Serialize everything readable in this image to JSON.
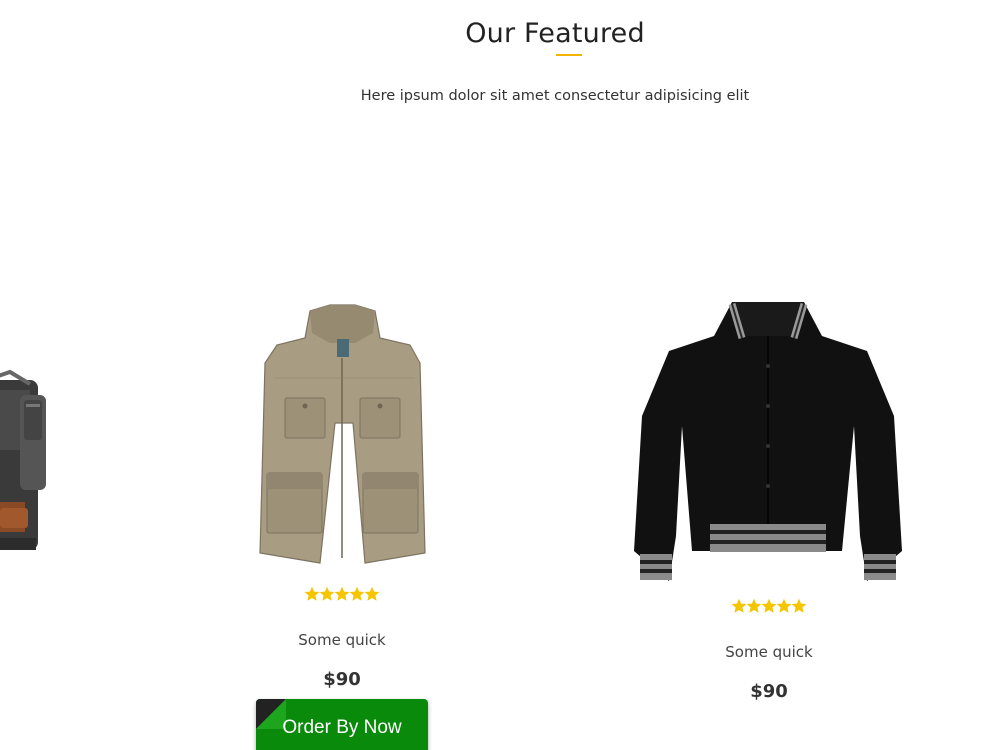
{
  "section": {
    "title": "Our Featured",
    "subtitle": "Here ipsum dolor sit amet consectetur adipisicing elit"
  },
  "products": [
    {
      "id": "backpack",
      "name": "",
      "price": ""
    },
    {
      "id": "vest",
      "name": "Some quick",
      "price": "$90",
      "rating": 5
    },
    {
      "id": "jacket",
      "name": "Some quick",
      "price": "$90",
      "rating": 5
    }
  ],
  "order_button": {
    "label": "Order By Now"
  },
  "colors": {
    "accent_underline": "#f2b400",
    "star": "#f5c500",
    "button_green": "#0a8a0a"
  }
}
